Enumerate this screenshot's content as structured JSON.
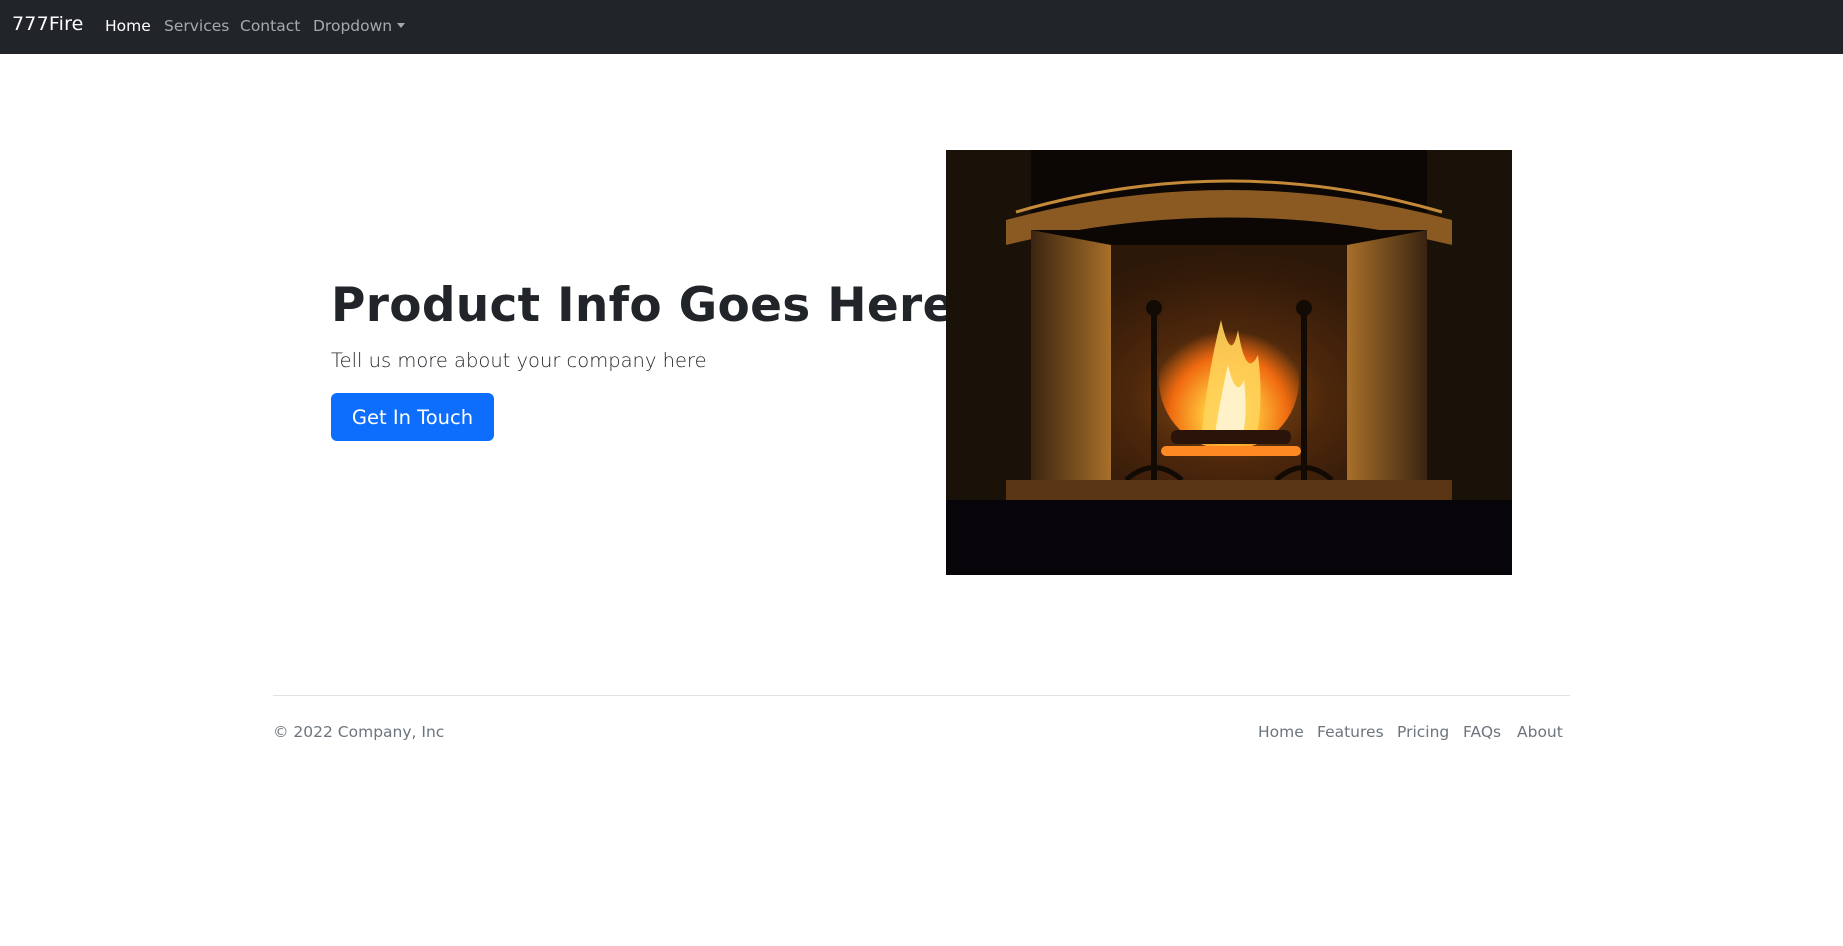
{
  "navbar": {
    "brand": "777Fire",
    "links": [
      {
        "label": "Home",
        "active": true
      },
      {
        "label": "Services",
        "active": false
      },
      {
        "label": "Contact",
        "active": false
      },
      {
        "label": "Dropdown",
        "active": false
      }
    ],
    "background": "#212529"
  },
  "hero": {
    "title": "Product Info Goes Here",
    "subtitle": "Tell us more about your company here",
    "cta_label": "Get In Touch",
    "cta_color": "#0d6efd",
    "image": "fireplace-photo"
  },
  "footer": {
    "copyright": "© 2022 Company, Inc",
    "links": [
      "Home",
      "Features",
      "Pricing",
      "FAQs",
      "About"
    ]
  }
}
